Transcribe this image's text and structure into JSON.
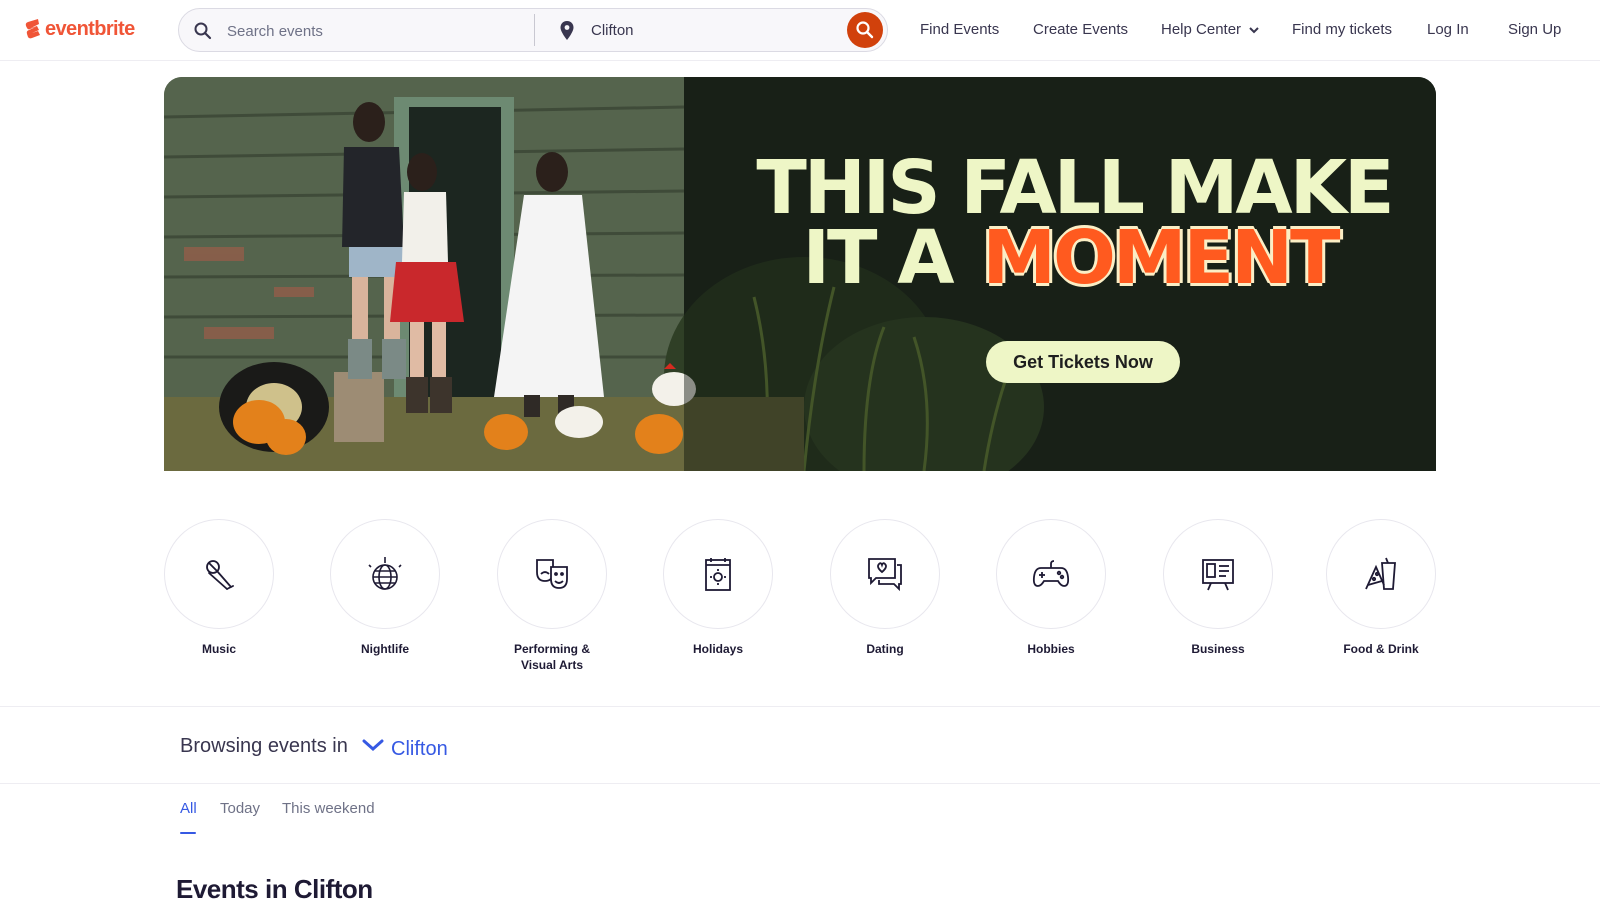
{
  "brand": {
    "name": "eventbrite",
    "color": "#f05537"
  },
  "search": {
    "placeholder": "Search events",
    "location_value": "Clifton",
    "button_color": "#d1410c"
  },
  "nav": {
    "find_events": "Find Events",
    "create_events": "Create Events",
    "help_center": "Help Center",
    "find_tickets": "Find my tickets",
    "log_in": "Log In",
    "sign_up": "Sign Up"
  },
  "hero": {
    "headline_line1": "THIS FALL MAKE",
    "headline_line2a": "IT A",
    "headline_line2b": "MOMENT",
    "cta": "Get Tickets Now",
    "accent_color": "#ff5a1f",
    "text_color": "#eef6c6"
  },
  "categories": [
    {
      "label": "Music",
      "icon": "microphone-icon"
    },
    {
      "label": "Nightlife",
      "icon": "disco-ball-icon"
    },
    {
      "label": "Performing & Visual Arts",
      "icon": "theater-masks-icon"
    },
    {
      "label": "Holidays",
      "icon": "calendar-sun-icon"
    },
    {
      "label": "Dating",
      "icon": "chat-heart-icon"
    },
    {
      "label": "Hobbies",
      "icon": "gamepad-icon"
    },
    {
      "label": "Business",
      "icon": "presentation-board-icon"
    },
    {
      "label": "Food & Drink",
      "icon": "food-drink-icon"
    }
  ],
  "browsing": {
    "label": "Browsing events in",
    "location": "Clifton",
    "link_color": "#3659e3"
  },
  "tabs": [
    {
      "label": "All",
      "active": true
    },
    {
      "label": "Today",
      "active": false
    },
    {
      "label": "This weekend",
      "active": false
    }
  ],
  "events_title": "Events in Clifton"
}
